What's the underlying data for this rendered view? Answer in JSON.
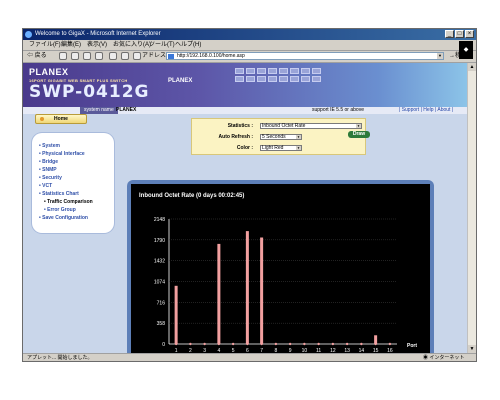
{
  "window": {
    "title": "Welcome to GigaX - Microsoft Internet Explorer"
  },
  "menu": {
    "items": [
      "ファイル(F)",
      "編集(E)",
      "表示(V)",
      "お気に入り(A)",
      "ツール(T)",
      "ヘルプ(H)"
    ]
  },
  "toolbar": {
    "back": "戻る",
    "address_label": "アドレス(D)",
    "address_url": "http://192.168.0.100/home.asp",
    "go_label": "移動"
  },
  "banner": {
    "brand": "PLANEX",
    "subtitle": "16PORT GIGABIT WEB SMART PLUS SWITCH",
    "model": "SWP-0412G",
    "brand2": "PLANEX"
  },
  "navbar": {
    "system_name_label": "system name",
    "system_name_value": "PLANEX",
    "support": "support IE 5.5 or above",
    "links": "| Support | Help | About |"
  },
  "home": {
    "label": "Home"
  },
  "sidebar": {
    "items": [
      "• System",
      "• Physical Interface",
      "• Bridge",
      "• SNMP",
      "• Security",
      "• VCT",
      "• Statistics Chart",
      "• Traffic Comparison",
      "• Error Group",
      "• Save Configuration"
    ]
  },
  "controls": {
    "statistics_label": "Statistics :",
    "statistics_value": "Inbound Octet Rate",
    "refresh_label": "Auto Refresh :",
    "refresh_value": "5 Seconds",
    "color_label": "Color :",
    "color_value": "Light Red",
    "draw_button": "Draw"
  },
  "status": {
    "text": "アプレット... 開始しました。",
    "zone": "インターネット"
  },
  "colors": {
    "bar": "#f2a0a0",
    "chart_bg": "#000000",
    "frame": "#5d7fb8",
    "banner_start": "#4a3a8c",
    "banner_end": "#8cc4e8",
    "panel_bg": "#fbf3c3"
  },
  "chart_data": {
    "type": "bar",
    "title": "Inbound Octet Rate (0 days 00:02:45)",
    "xlabel": "Port",
    "ylim": [
      0,
      2148
    ],
    "yticks": [
      0,
      358,
      716,
      1074,
      1432,
      1790,
      2148
    ],
    "categories": [
      "1",
      "2",
      "3",
      "4",
      "5",
      "6",
      "7",
      "8",
      "9",
      "10",
      "11",
      "12",
      "13",
      "14",
      "15",
      "16"
    ],
    "values": [
      1000,
      0,
      0,
      1720,
      0,
      1940,
      1830,
      0,
      0,
      0,
      0,
      0,
      0,
      0,
      150,
      0
    ]
  }
}
